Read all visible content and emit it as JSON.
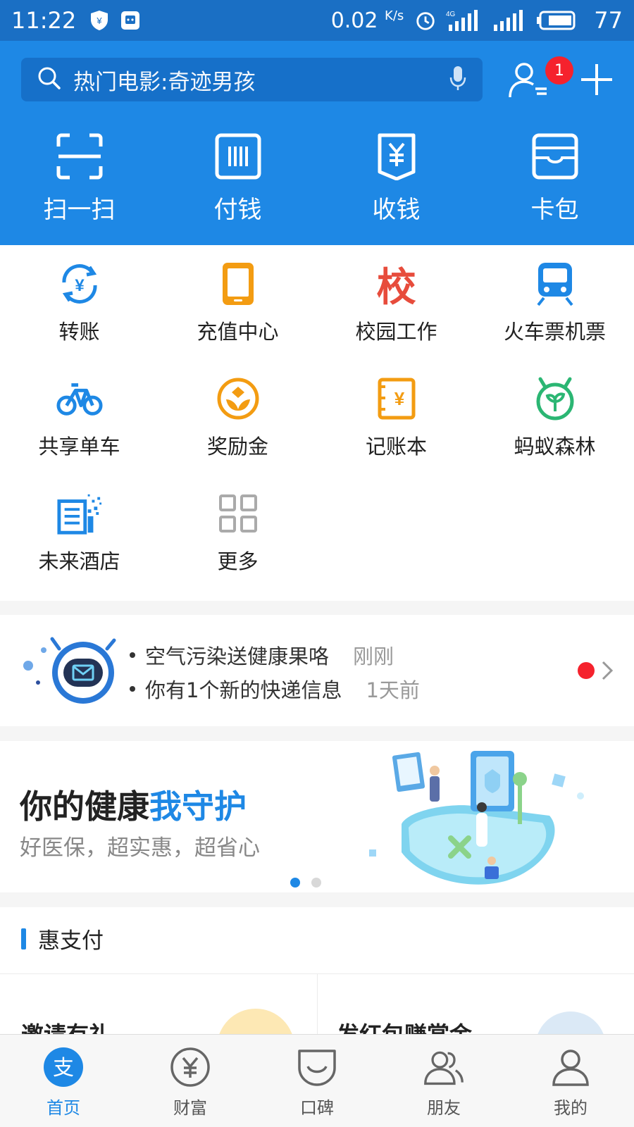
{
  "status_bar": {
    "time": "11:22",
    "speed": "0.02",
    "speed_unit": "K/s",
    "network": "4G",
    "battery": "77"
  },
  "header": {
    "search_placeholder": "热门电影:奇迹男孩",
    "notification_count": "1",
    "quick_actions": [
      {
        "label": "扫一扫",
        "icon": "scan-icon"
      },
      {
        "label": "付钱",
        "icon": "pay-code-icon"
      },
      {
        "label": "收钱",
        "icon": "receive-money-icon"
      },
      {
        "label": "卡包",
        "icon": "card-wallet-icon"
      }
    ]
  },
  "apps": [
    {
      "label": "转账",
      "icon": "transfer-icon",
      "color": "#1e88e5"
    },
    {
      "label": "充值中心",
      "icon": "phone-recharge-icon",
      "color": "#f39c12"
    },
    {
      "label": "校园工作",
      "icon": "campus-icon",
      "color": "#e74c3c",
      "glyph": "校"
    },
    {
      "label": "火车票机票",
      "icon": "train-icon",
      "color": "#1e88e5"
    },
    {
      "label": "共享单车",
      "icon": "bike-icon",
      "color": "#1e88e5"
    },
    {
      "label": "奖励金",
      "icon": "reward-icon",
      "color": "#f39c12"
    },
    {
      "label": "记账本",
      "icon": "ledger-icon",
      "color": "#f39c12"
    },
    {
      "label": "蚂蚁森林",
      "icon": "forest-icon",
      "color": "#2bb673"
    },
    {
      "label": "未来酒店",
      "icon": "hotel-icon",
      "color": "#1e88e5"
    },
    {
      "label": "更多",
      "icon": "more-grid-icon",
      "color": "#aaaaaa"
    }
  ],
  "notice": {
    "items": [
      {
        "text": "空气污染送健康果咯",
        "time": "刚刚"
      },
      {
        "text": "你有1个新的快递信息",
        "time": "1天前"
      }
    ]
  },
  "banner": {
    "title_prefix": "你的健康",
    "title_highlight": "我守护",
    "subtitle": "好医保，超实惠，超省心",
    "page_count": 2,
    "active_page": 1
  },
  "hui_zhifu": {
    "title": "惠支付",
    "cards": [
      {
        "title": "邀请有礼"
      },
      {
        "title": "发红包赚赏金"
      }
    ]
  },
  "tabbar": {
    "tabs": [
      {
        "label": "首页",
        "icon": "home-alipay-icon",
        "active": true
      },
      {
        "label": "财富",
        "icon": "wealth-icon",
        "active": false
      },
      {
        "label": "口碑",
        "icon": "koubei-icon",
        "active": false
      },
      {
        "label": "朋友",
        "icon": "friends-icon",
        "active": false
      },
      {
        "label": "我的",
        "icon": "profile-icon",
        "active": false
      }
    ]
  },
  "colors": {
    "brand_blue": "#1e88e5",
    "status_bar_blue": "#1a6fc4",
    "alert_red": "#f5222d"
  }
}
